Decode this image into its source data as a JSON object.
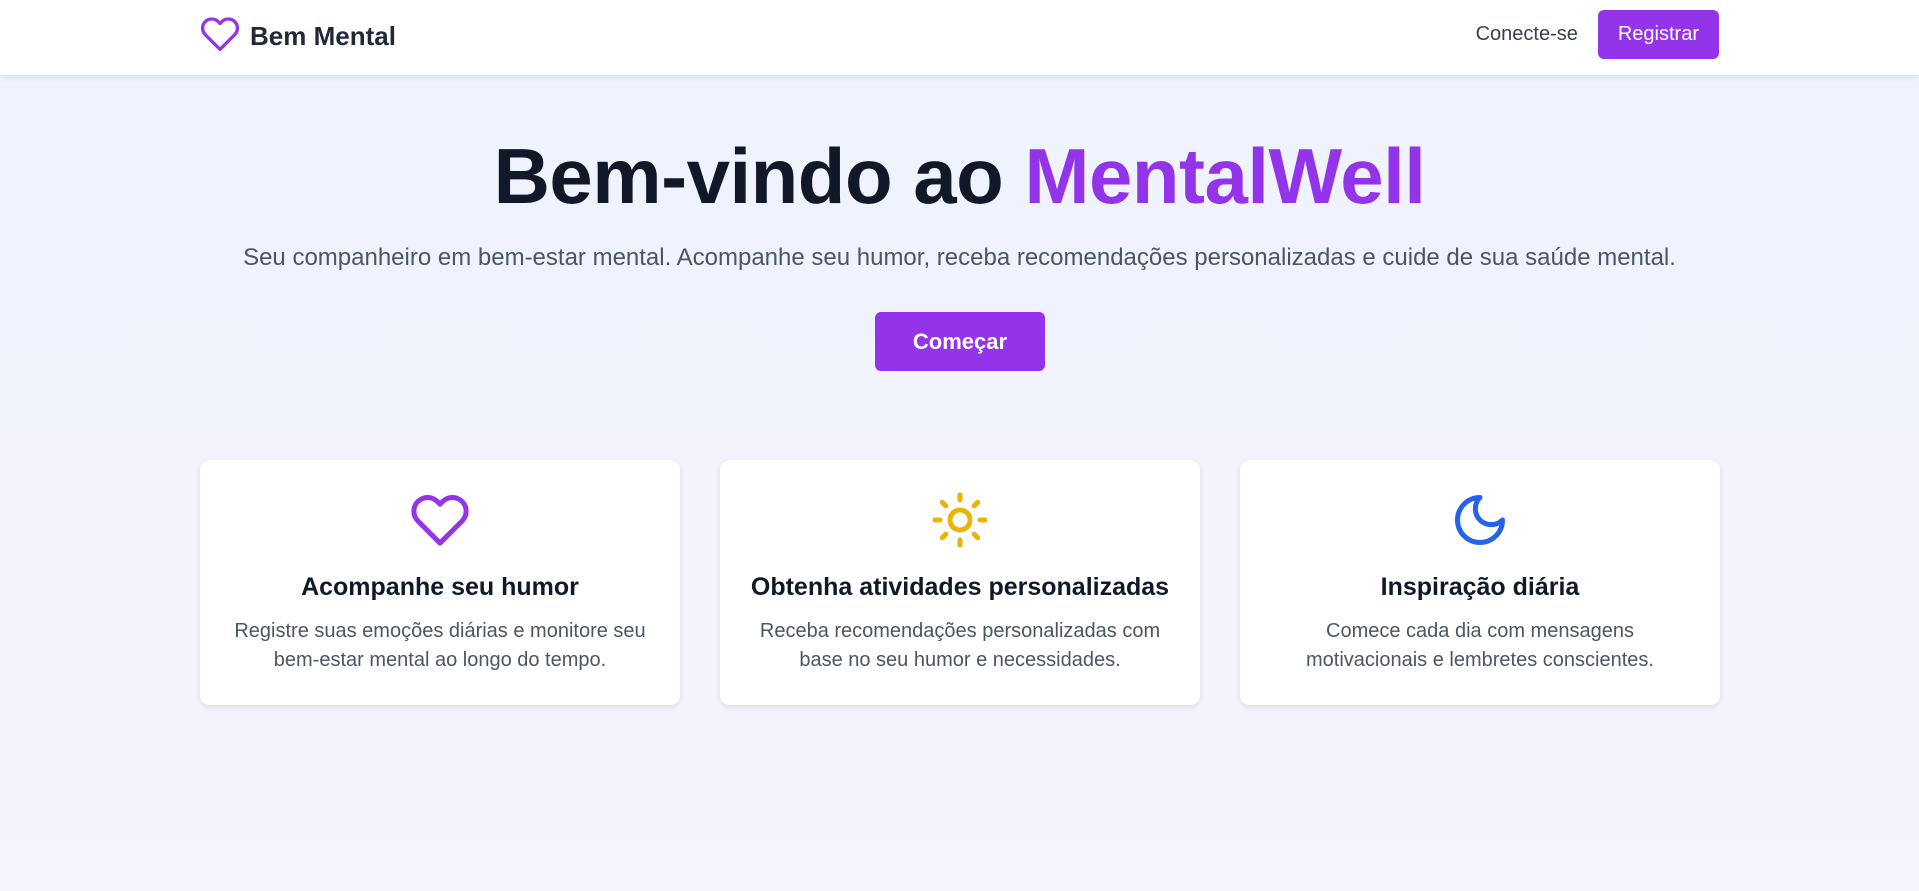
{
  "nav": {
    "brand_name": "Bem Mental",
    "login_label": "Conecte-se",
    "register_label": "Registrar"
  },
  "hero": {
    "title_prefix": "Bem-vindo ao ",
    "title_accent": "MentalWell",
    "subtitle": "Seu companheiro em bem-estar mental. Acompanhe seu humor, receba recomendações personalizadas e cuide de sua saúde mental.",
    "cta_label": "Começar"
  },
  "features": [
    {
      "icon": "heart-icon",
      "title": "Acompanhe seu humor",
      "description": "Registre suas emoções diárias e monitore seu bem-estar mental ao longo do tempo.",
      "color": "#9333ea"
    },
    {
      "icon": "sun-icon",
      "title": "Obtenha atividades personalizadas",
      "description": "Receba recomendações personalizadas com base no seu humor e necessidades.",
      "color": "#eab308"
    },
    {
      "icon": "moon-icon",
      "title": "Inspiração diária",
      "description": "Comece cada dia com mensagens motivacionais e lembretes conscientes.",
      "color": "#2563eb"
    }
  ],
  "colors": {
    "accent": "#9333ea",
    "background": "#f0f4fd"
  }
}
